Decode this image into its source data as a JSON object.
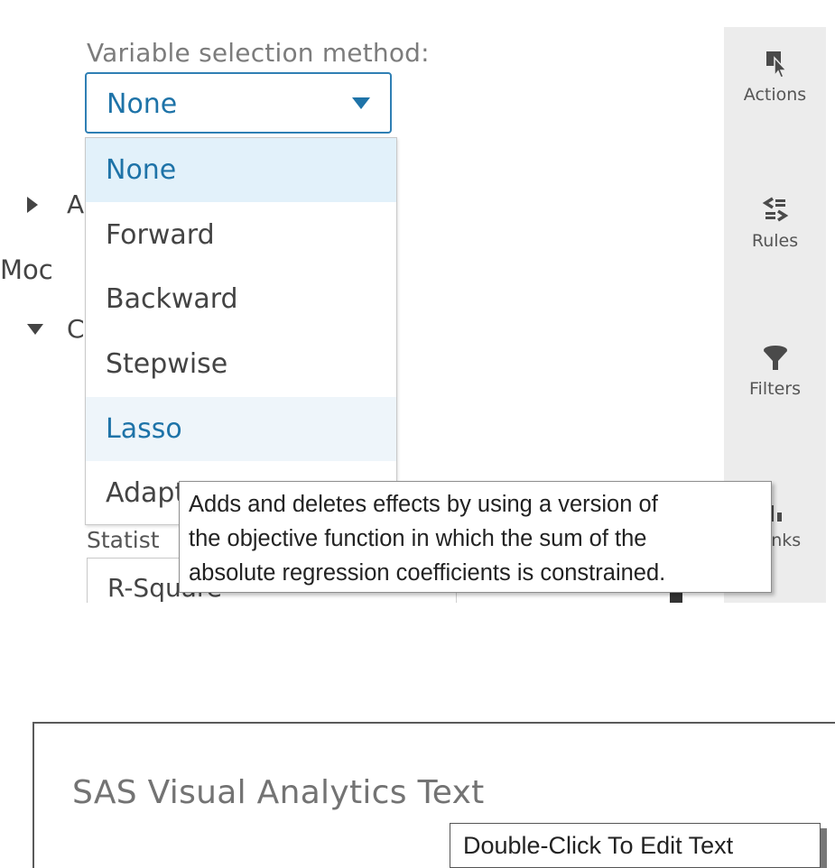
{
  "variable_selection": {
    "label": "Variable selection method:",
    "selected": "None"
  },
  "dropdown_options": [
    "None",
    "Forward",
    "Backward",
    "Stepwise",
    "Lasso",
    "Adaptive LASSO"
  ],
  "dropdown_selected_index": 0,
  "dropdown_hover_index": 4,
  "partially_hidden": {
    "collapsed_section_initial": "A",
    "model_heading_partial": "Moc",
    "expanded_section_initial": "C",
    "statistic_label_partial": "Statist",
    "statistic_value_partial": "R-Square"
  },
  "tooltip": {
    "lines": [
      "Adds and deletes effects by using a version of",
      "the objective function in which the sum of the",
      "absolute regression coefficients is constrained."
    ]
  },
  "right_rail": {
    "items": [
      {
        "label": "Actions",
        "icon": "cursor-icon"
      },
      {
        "label": "Rules",
        "icon": "rules-icon"
      },
      {
        "label": "Filters",
        "icon": "filter-icon"
      },
      {
        "label": "Ranks",
        "icon": "ranks-icon"
      }
    ]
  },
  "text_object": {
    "content": "SAS Visual Analytics Text",
    "hint": "Double-Click To Edit Text"
  },
  "colors": {
    "accent": "#1e73a8",
    "selected_bg": "#e2f1fa",
    "rail_bg": "#ececec"
  }
}
